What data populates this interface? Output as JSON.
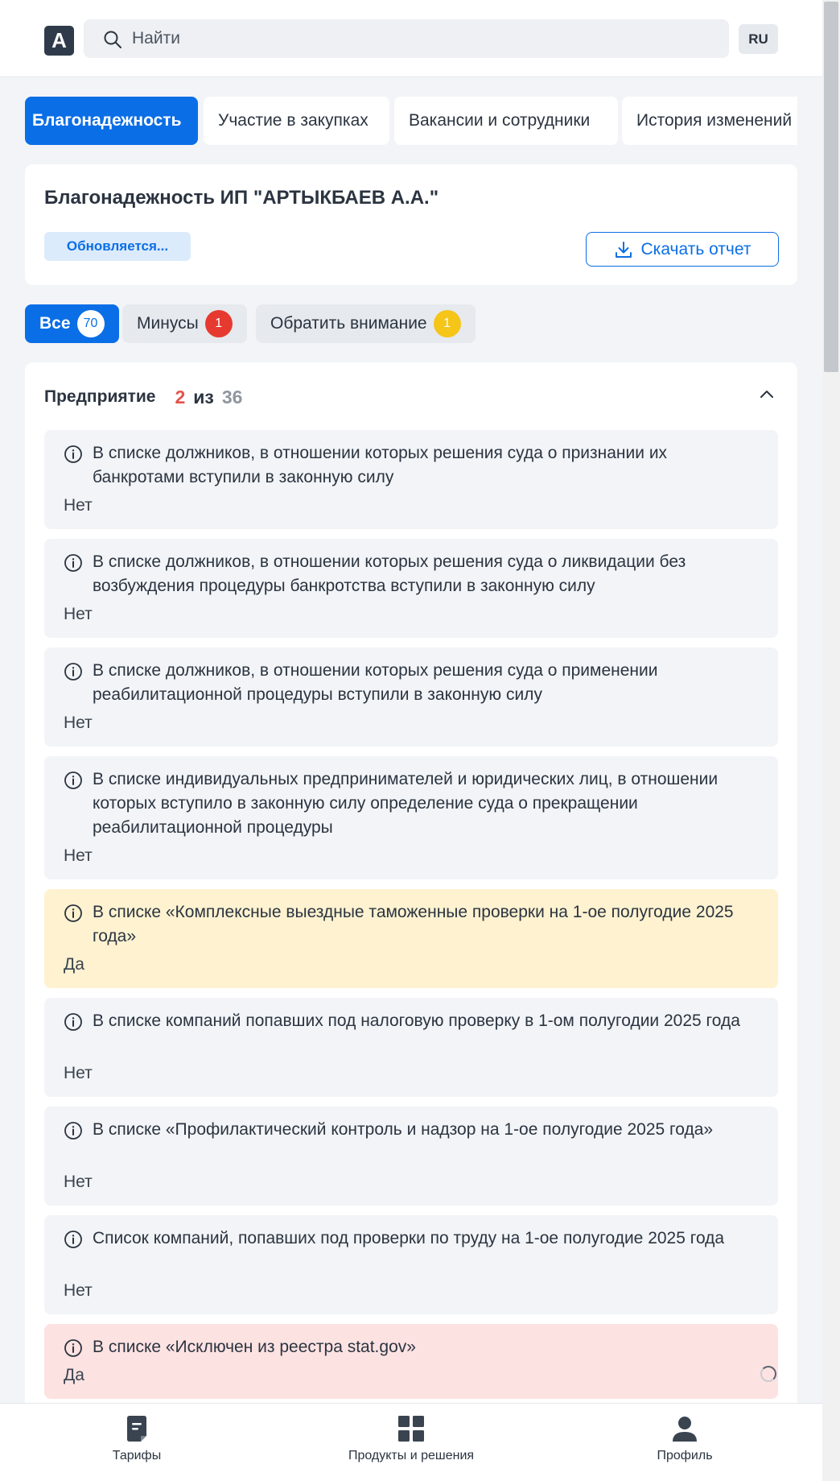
{
  "header": {
    "logo": "A",
    "search_placeholder": "Найти",
    "lang": "RU"
  },
  "tabs": [
    {
      "label": "Благонадежность"
    },
    {
      "label": "Участие в закупках"
    },
    {
      "label": "Вакансии и сотрудники"
    },
    {
      "label": "История изменений"
    }
  ],
  "title_card": {
    "title": "Благонадежность ИП \"АРТЫКБАЕВ А.А.\"",
    "updating": "Обновляется...",
    "download": "Скачать отчет"
  },
  "filters": [
    {
      "label": "Все",
      "count": "70"
    },
    {
      "label": "Минусы",
      "count": "1"
    },
    {
      "label": "Обратить внимание",
      "count": "1"
    }
  ],
  "section": {
    "title": "Предприятие",
    "matched": "2",
    "of": "из",
    "total": "36"
  },
  "items": [
    {
      "title": "В списке должников, в отношении которых решения суда о признании их банкротами вступили в законную силу",
      "value": "Нет",
      "status": "neutral"
    },
    {
      "title": "В списке должников, в отношении которых решения суда о ликвидации без возбуждения процедуры банкротства вступили в законную силу",
      "value": "Нет",
      "status": "neutral"
    },
    {
      "title": "В списке должников, в отношении которых решения суда о применении реабилитационной процедуры вступили в законную силу",
      "value": "Нет",
      "status": "neutral"
    },
    {
      "title": "В списке индивидуальных предпринимателей и юридических лиц, в отношении которых вступило в законную силу определение суда о прекращении реабилитационной процедуры",
      "value": "Нет",
      "status": "neutral"
    },
    {
      "title": "В списке «Комплексные выездные таможенные проверки на 1-ое полугодие 2025 года»",
      "value": "Да",
      "status": "warning"
    },
    {
      "title": "В списке компаний попавших под налоговую проверку в 1-ом полугодии 2025 года",
      "value": "Нет",
      "status": "neutral"
    },
    {
      "title": "В списке «Профилактический контроль и надзор на 1-ое полугодие 2025 года»",
      "value": "Нет",
      "status": "neutral"
    },
    {
      "title": "Список компаний, попавших под проверки по труду на 1-ое полугодие 2025 года",
      "value": "Нет",
      "status": "neutral"
    },
    {
      "title": "В списке «Исключен из реестра stat.gov»",
      "value": "Да",
      "status": "negative"
    }
  ],
  "bottom_nav": [
    {
      "label": "Тарифы",
      "icon": "tariffs-icon"
    },
    {
      "label": "Продукты и решения",
      "icon": "grid-icon"
    },
    {
      "label": "Профиль",
      "icon": "profile-icon"
    }
  ],
  "colors": {
    "accent": "#0a6ee6",
    "warning_bg": "#fef2d0",
    "negative_bg": "#fde2e2",
    "negative_badge": "#e63a30",
    "warning_badge": "#f5c518"
  }
}
